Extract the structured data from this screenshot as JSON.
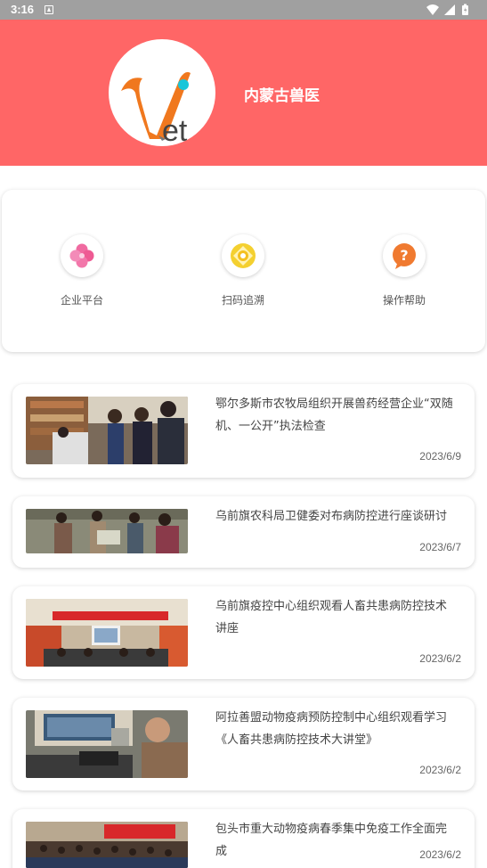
{
  "status_bar": {
    "time": "3:16"
  },
  "header": {
    "title": "内蒙古兽医",
    "logo_text": "Vet"
  },
  "menu": [
    {
      "label": "企业平台",
      "icon": "flower-icon"
    },
    {
      "label": "扫码追溯",
      "icon": "scan-icon"
    },
    {
      "label": "操作帮助",
      "icon": "help-icon"
    }
  ],
  "news": [
    {
      "title": "鄂尔多斯市农牧局组织开展兽药经营企业“双随机、一公开”执法检查",
      "date": "2023/6/9"
    },
    {
      "title": "乌前旗农科局卫健委对布病防控进行座谈研讨",
      "date": "2023/6/7"
    },
    {
      "title": "乌前旗疫控中心组织观看人畜共患病防控技术讲座",
      "date": "2023/6/2"
    },
    {
      "title": "阿拉善盟动物疫病预防控制中心组织观看学习《人畜共患病防控技术大讲堂》",
      "date": "2023/6/2"
    },
    {
      "title": "包头市重大动物疫病春季集中免疫工作全面完成",
      "date": "2023/6/2"
    }
  ],
  "colors": {
    "header_bg": "#ff6666",
    "status_bg": "#a0a0a0"
  }
}
